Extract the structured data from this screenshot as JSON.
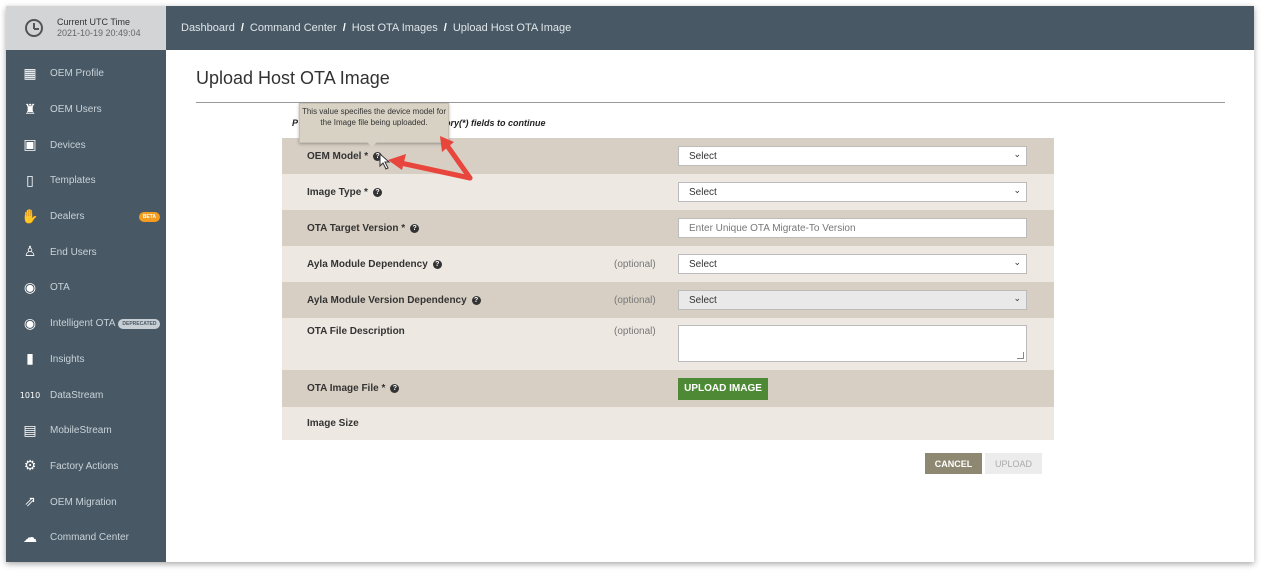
{
  "clock": {
    "label": "Current UTC Time",
    "time": "2021-10-19 20:49:04"
  },
  "breadcrumb": [
    "Dashboard",
    "Command Center",
    "Host OTA Images",
    "Upload Host OTA Image"
  ],
  "sidebar": {
    "items": [
      {
        "label": "OEM Profile",
        "icon": "oem-profile-icon"
      },
      {
        "label": "OEM Users",
        "icon": "oem-users-icon"
      },
      {
        "label": "Devices",
        "icon": "devices-icon"
      },
      {
        "label": "Templates",
        "icon": "templates-icon"
      },
      {
        "label": "Dealers",
        "icon": "dealers-icon",
        "badge": "BETA"
      },
      {
        "label": "End Users",
        "icon": "end-users-icon"
      },
      {
        "label": "OTA",
        "icon": "ota-icon"
      },
      {
        "label": "Intelligent OTA",
        "icon": "intelligent-ota-icon",
        "badge": "DEPRECATED"
      },
      {
        "label": "Insights",
        "icon": "insights-icon"
      },
      {
        "label": "DataStream",
        "icon": "datastream-icon"
      },
      {
        "label": "MobileStream",
        "icon": "mobilestream-icon"
      },
      {
        "label": "Factory Actions",
        "icon": "factory-actions-icon"
      },
      {
        "label": "OEM Migration",
        "icon": "oem-migration-icon"
      },
      {
        "label": "Command Center",
        "icon": "command-center-icon"
      }
    ]
  },
  "page": {
    "title": "Upload Host OTA Image",
    "notice_prefix": "P",
    "notice_suffix": "atory(*) fields to continue"
  },
  "tooltip": "This value specifies the device model for the Image file being uploaded.",
  "form": {
    "oem_model": {
      "label": "OEM Model *",
      "value": "Select"
    },
    "image_type": {
      "label": "Image Type *",
      "value": "Select"
    },
    "ota_target_version": {
      "label": "OTA Target Version *",
      "placeholder": "Enter Unique OTA Migrate-To Version"
    },
    "ayla_module_dependency": {
      "label": "Ayla Module Dependency",
      "optional": "(optional)",
      "value": "Select"
    },
    "ayla_module_version_dependency": {
      "label": "Ayla Module Version Dependency",
      "optional": "(optional)",
      "value": "Select"
    },
    "ota_file_description": {
      "label": "OTA File Description",
      "optional": "(optional)"
    },
    "ota_image_file": {
      "label": "OTA Image File *",
      "button": "UPLOAD IMAGE"
    },
    "image_size": {
      "label": "Image Size"
    }
  },
  "actions": {
    "cancel": "CANCEL",
    "upload": "UPLOAD"
  },
  "colors": {
    "sidebar": "#485864",
    "accent_green": "#4e8a35",
    "row_dark": "#d7cfc4",
    "row_light": "#ede8e2",
    "badge_orange": "#f39c1f",
    "annotation_red": "#e8453c"
  }
}
